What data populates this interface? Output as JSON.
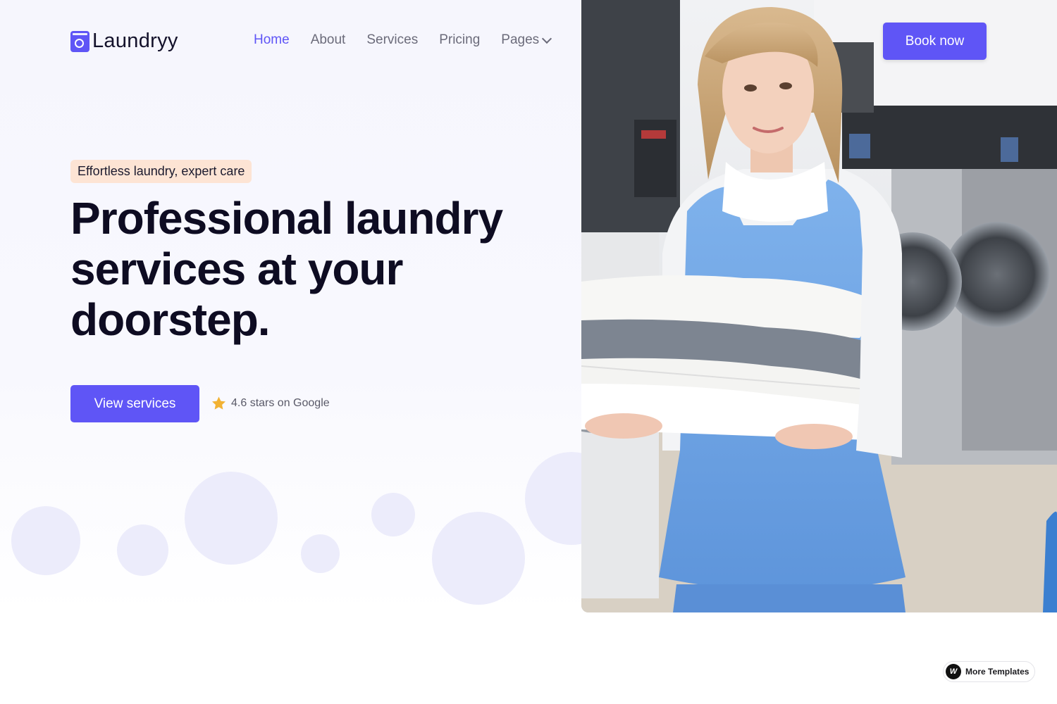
{
  "brand": {
    "name": "Laundryy",
    "accent": "#5f55f6"
  },
  "nav": {
    "items": [
      {
        "label": "Home",
        "active": true
      },
      {
        "label": "About",
        "active": false
      },
      {
        "label": "Services",
        "active": false
      },
      {
        "label": "Pricing",
        "active": false
      },
      {
        "label": "Pages",
        "active": false,
        "has_dropdown": true
      }
    ]
  },
  "header": {
    "cta_label": "Book now"
  },
  "hero": {
    "badge": "Effortless laundry, expert care",
    "headline": "Professional laundry services at your doorstep.",
    "cta_label": "View services",
    "rating_text": "4.6 stars on Google",
    "rating_icon": "star-icon",
    "badge_color": "#fde4d4"
  },
  "photo": {
    "subject": "laundry-worker-holding-folded-towels"
  },
  "footer_widget": {
    "label": "More Templates",
    "icon": "webflow-logo-icon"
  }
}
